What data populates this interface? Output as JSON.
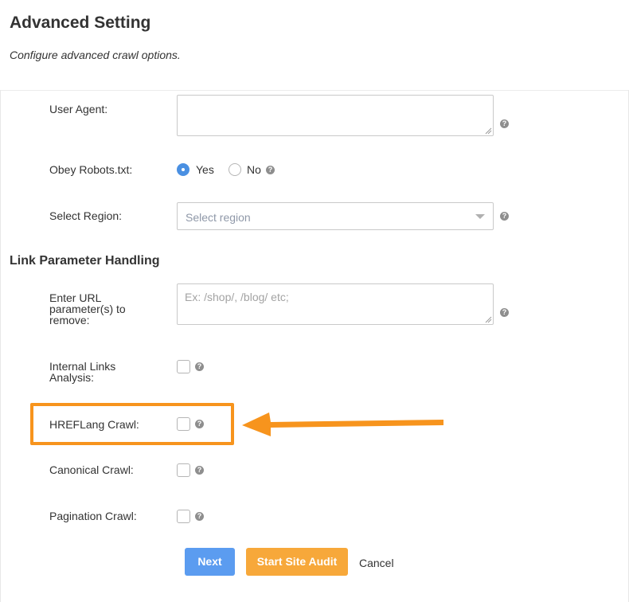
{
  "header": {
    "title": "Advanced Setting",
    "subtitle": "Configure advanced crawl options."
  },
  "user_agent": {
    "label": "User Agent:",
    "value": ""
  },
  "obey_robots": {
    "label": "Obey Robots.txt:",
    "options": [
      {
        "label": "Yes",
        "selected": true
      },
      {
        "label": "No",
        "selected": false
      }
    ]
  },
  "region": {
    "label": "Select Region:",
    "placeholder": "Select region",
    "value": ""
  },
  "link_params": {
    "title": "Link Parameter Handling",
    "url_params": {
      "label_lines": [
        "Enter URL",
        "parameter(s) to",
        "remove:"
      ],
      "placeholder": "Ex: /shop/, /blog/ etc;",
      "value": ""
    },
    "internal_links": {
      "label_lines": [
        "Internal Links",
        "Analysis:"
      ],
      "checked": false
    },
    "hreflang": {
      "label": "HREFLang Crawl:",
      "checked": false
    },
    "canonical": {
      "label": "Canonical Crawl:",
      "checked": false
    },
    "pagination": {
      "label": "Pagination Crawl:",
      "checked": false
    }
  },
  "help_glyph": "?",
  "actions": {
    "next_label": "Next",
    "start_label": "Start Site Audit",
    "cancel_label": "Cancel"
  },
  "colors": {
    "primary_blue": "#5b9cf0",
    "accent_orange": "#f7941d",
    "audit_orange": "#f7a83a"
  }
}
